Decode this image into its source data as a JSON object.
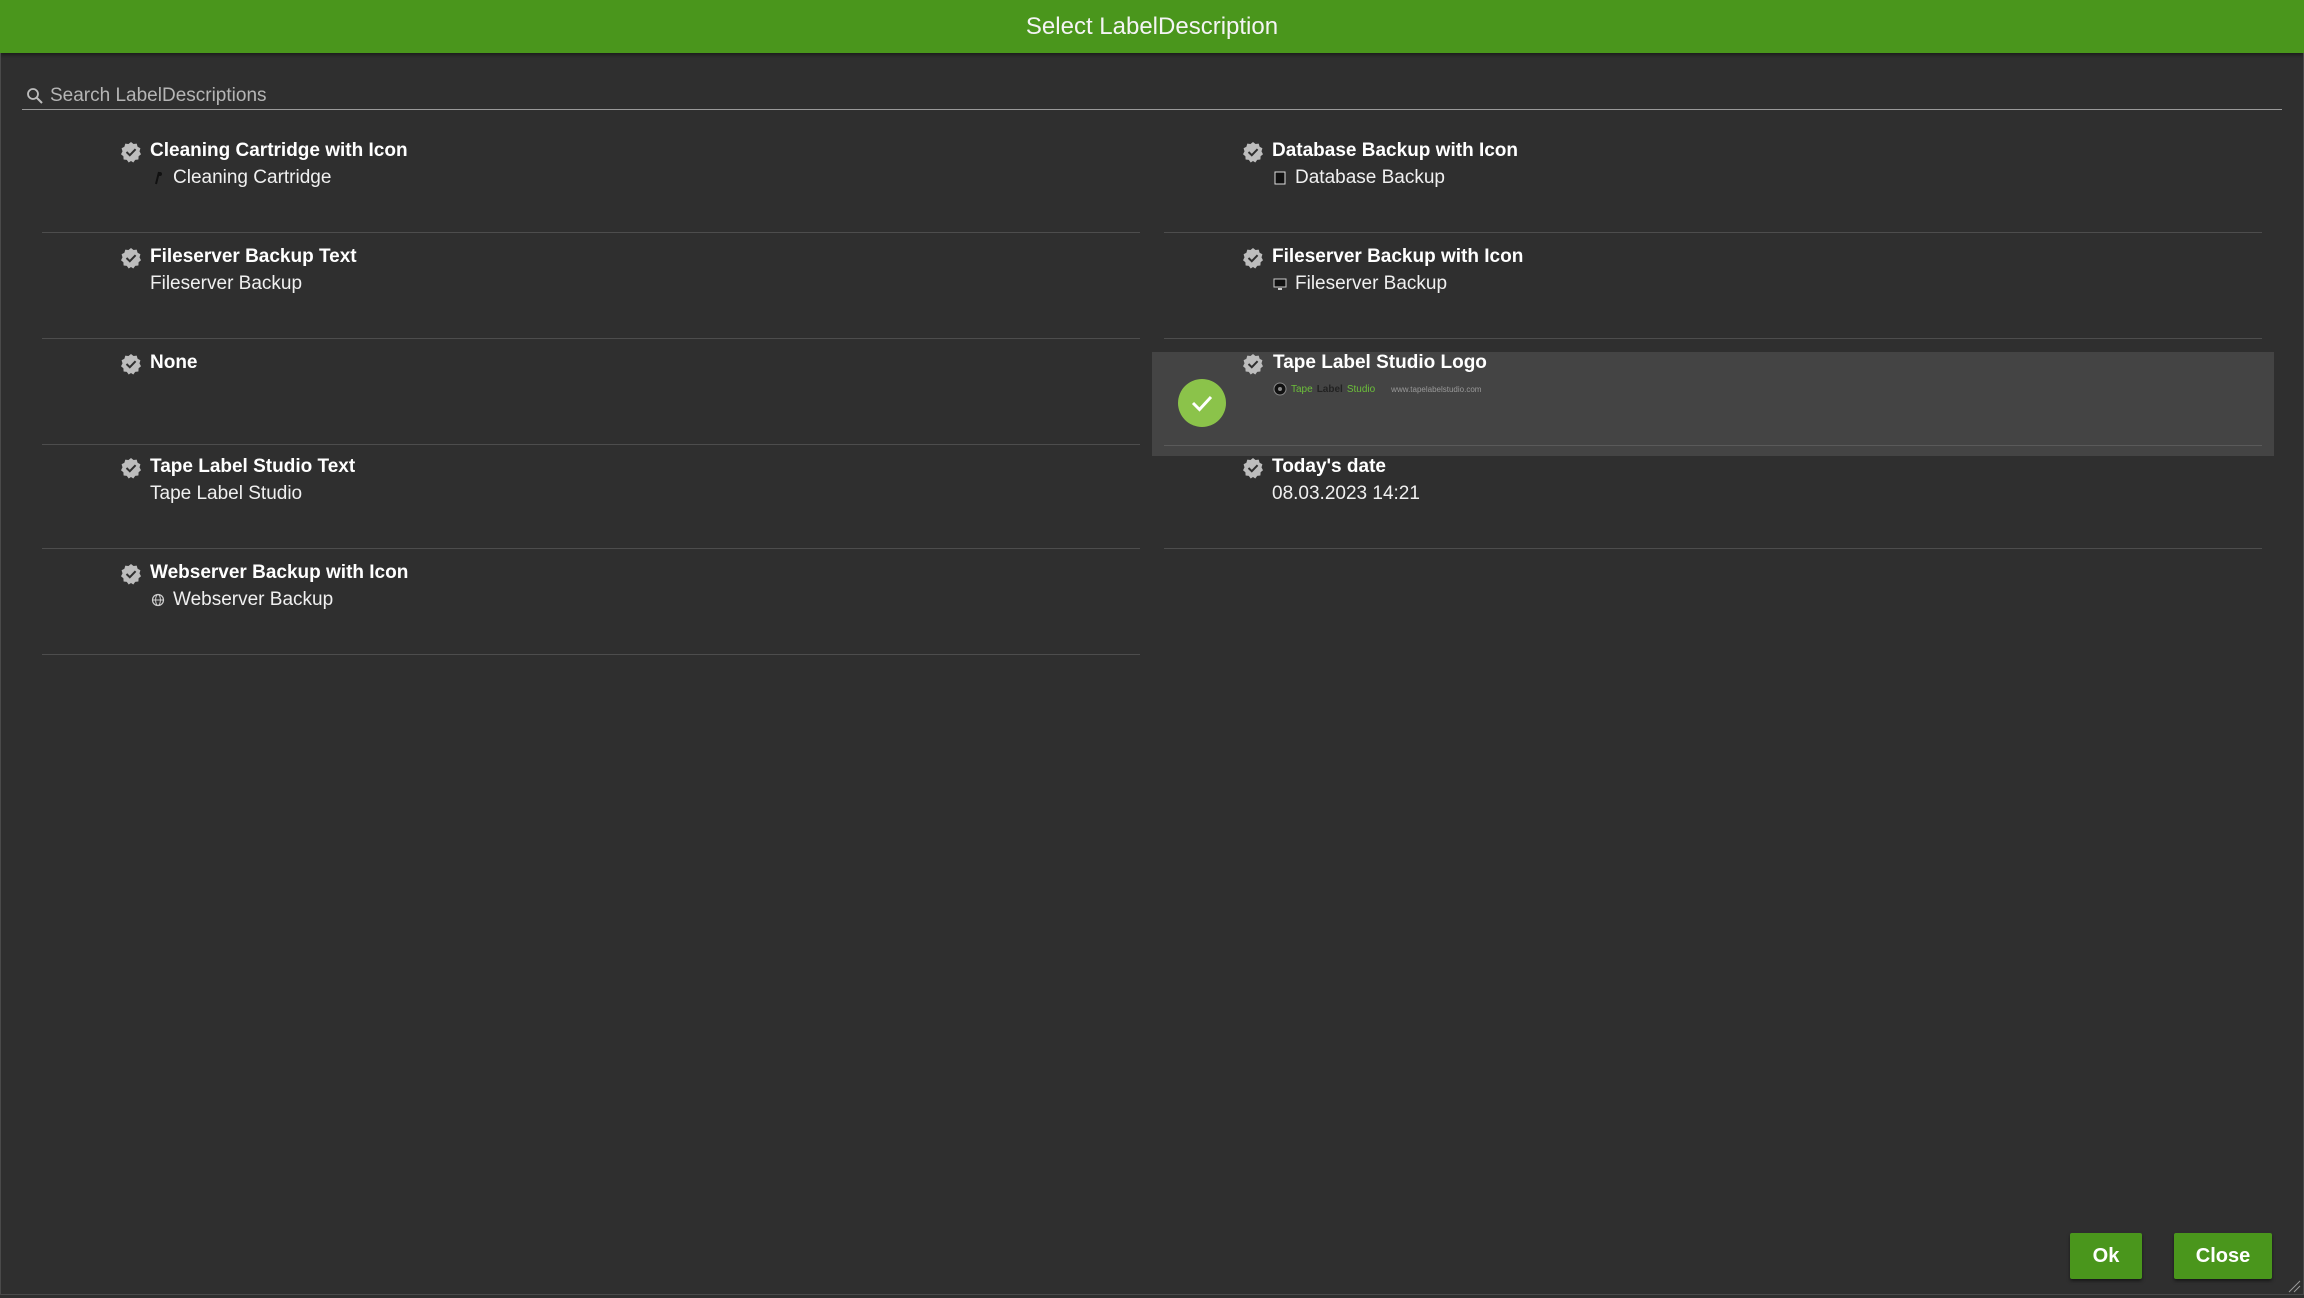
{
  "dialog": {
    "title": "Select LabelDescription"
  },
  "search": {
    "placeholder": "Search LabelDescriptions",
    "value": ""
  },
  "items": [
    {
      "name": "Cleaning Cartridge with Icon",
      "description": "Cleaning Cartridge",
      "icon": "cartridge-icon",
      "selected": false
    },
    {
      "name": "Database Backup with Icon",
      "description": "Database Backup",
      "icon": "database-icon",
      "selected": false
    },
    {
      "name": "Fileserver Backup Text",
      "description": "Fileserver Backup",
      "icon": "",
      "selected": false
    },
    {
      "name": "Fileserver Backup with Icon",
      "description": "Fileserver Backup",
      "icon": "server-icon",
      "selected": false
    },
    {
      "name": "None",
      "description": "",
      "icon": "",
      "selected": false
    },
    {
      "name": "Tape Label Studio Logo",
      "description": "",
      "icon": "logo-image",
      "selected": true,
      "logo": {
        "tape": "Tape",
        "label": "Label",
        "studio": "Studio",
        "url": "www.tapelabelstudio.com"
      }
    },
    {
      "name": "Tape Label Studio Text",
      "description": "Tape Label Studio",
      "icon": "",
      "selected": false
    },
    {
      "name": "Today's date",
      "description": "08.03.2023 14:21",
      "icon": "",
      "selected": false
    },
    {
      "name": "Webserver Backup with Icon",
      "description": "Webserver Backup",
      "icon": "globe-icon",
      "selected": false
    }
  ],
  "buttons": {
    "ok": "Ok",
    "close": "Close"
  },
  "colors": {
    "accent": "#4a961c",
    "selected_check": "#8bc34a",
    "background": "#2f2f2f"
  }
}
